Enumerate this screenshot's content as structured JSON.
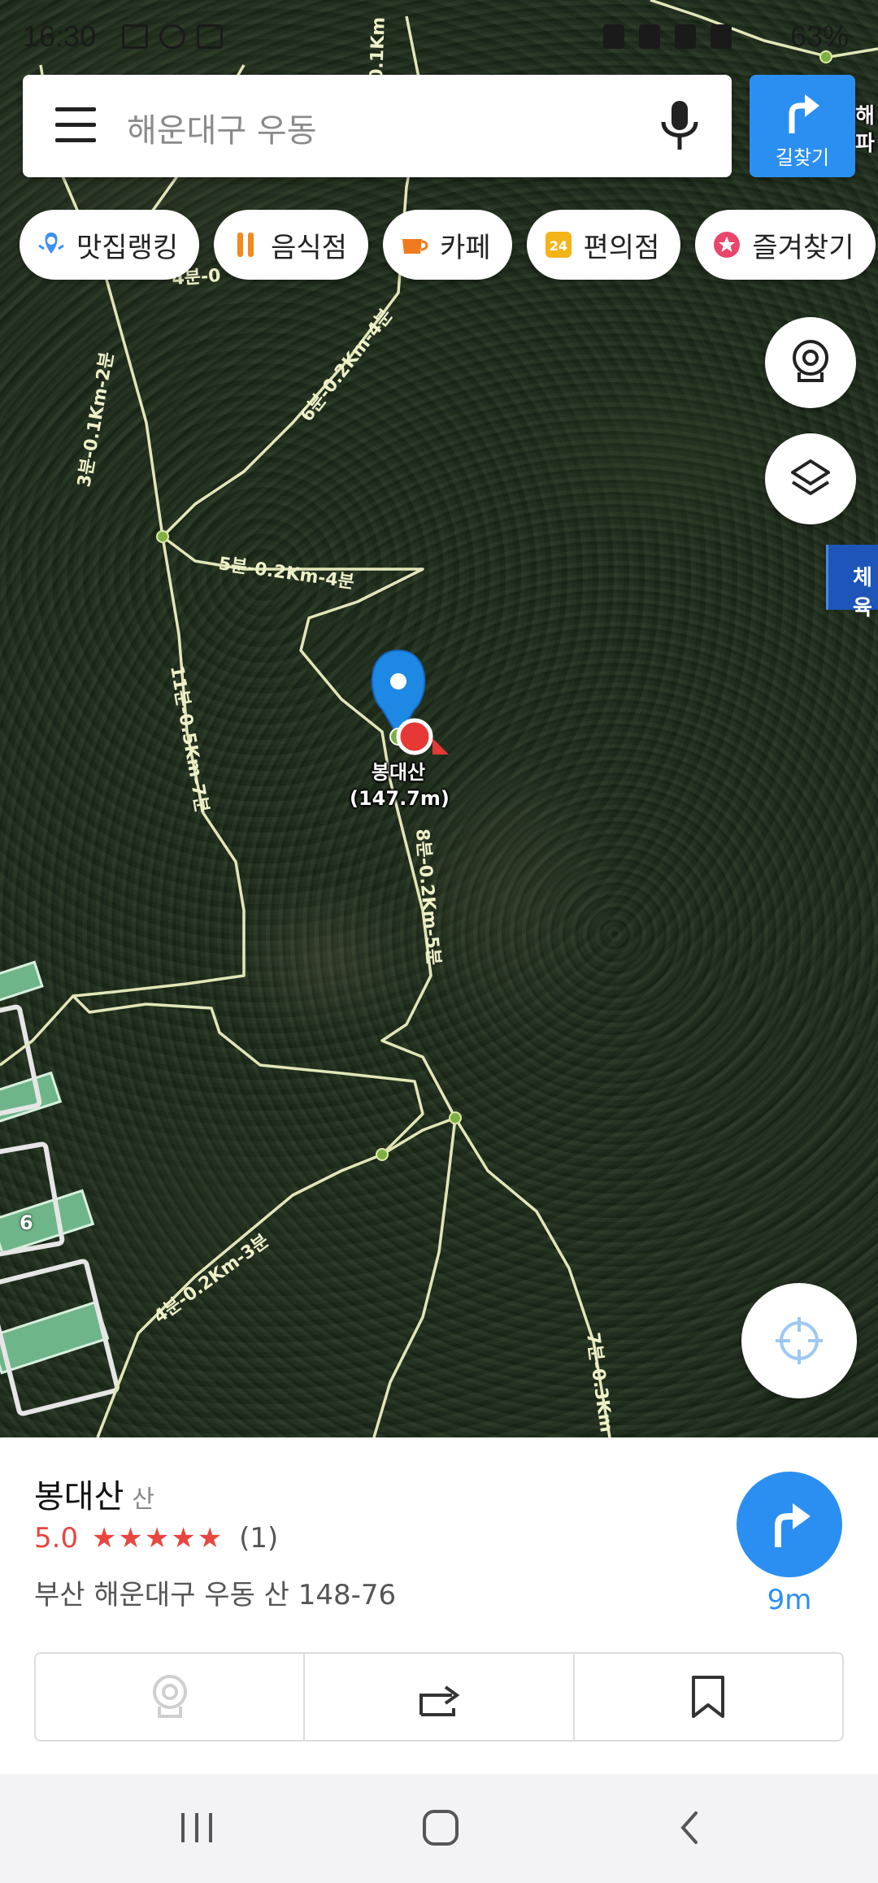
{
  "status_bar": {
    "time": "16:30",
    "battery": "63%"
  },
  "search": {
    "placeholder": "해운대구 우동",
    "route_label": "길찾기"
  },
  "chips": [
    {
      "label": "맛집랭킹",
      "icon": "ranking-pin-icon",
      "color": "#3d8ff0"
    },
    {
      "label": "음식점",
      "icon": "fork-knife-icon",
      "color": "#f08a1e"
    },
    {
      "label": "카페",
      "icon": "coffee-cup-icon",
      "color": "#f07a1e"
    },
    {
      "label": "편의점",
      "icon": "convenience-store-24-icon",
      "color": "#f2b418"
    },
    {
      "label": "즐겨찾기",
      "icon": "star-circle-icon",
      "color": "#e8466a"
    }
  ],
  "map": {
    "peak_name": "봉대산",
    "peak_elevation": "(147.7m)",
    "side_label_1": "체육",
    "side_label_2": "해",
    "side_label_3": "파",
    "building_number": "6",
    "trail_labels": [
      "6분-0.2Km-4분",
      "3분-0.1Km-2분",
      "5분-0.2Km-4분",
      "11분-0.5Km-7분",
      "8분-0.2Km-5분",
      "4분-0.2Km-3분",
      "7분-0.3Km",
      "4분-0",
      "0.1Km"
    ]
  },
  "place": {
    "name": "봉대산",
    "category": "산",
    "rating": "5.0",
    "stars": "★★★★★",
    "review_count": "(1)",
    "address": "부산 해운대구 우동 산 148-76",
    "distance": "9m"
  },
  "colors": {
    "accent": "#2b8ff2",
    "rating": "#e8463f",
    "pin": "#1e88e5",
    "trail": "#e2e6b8"
  }
}
